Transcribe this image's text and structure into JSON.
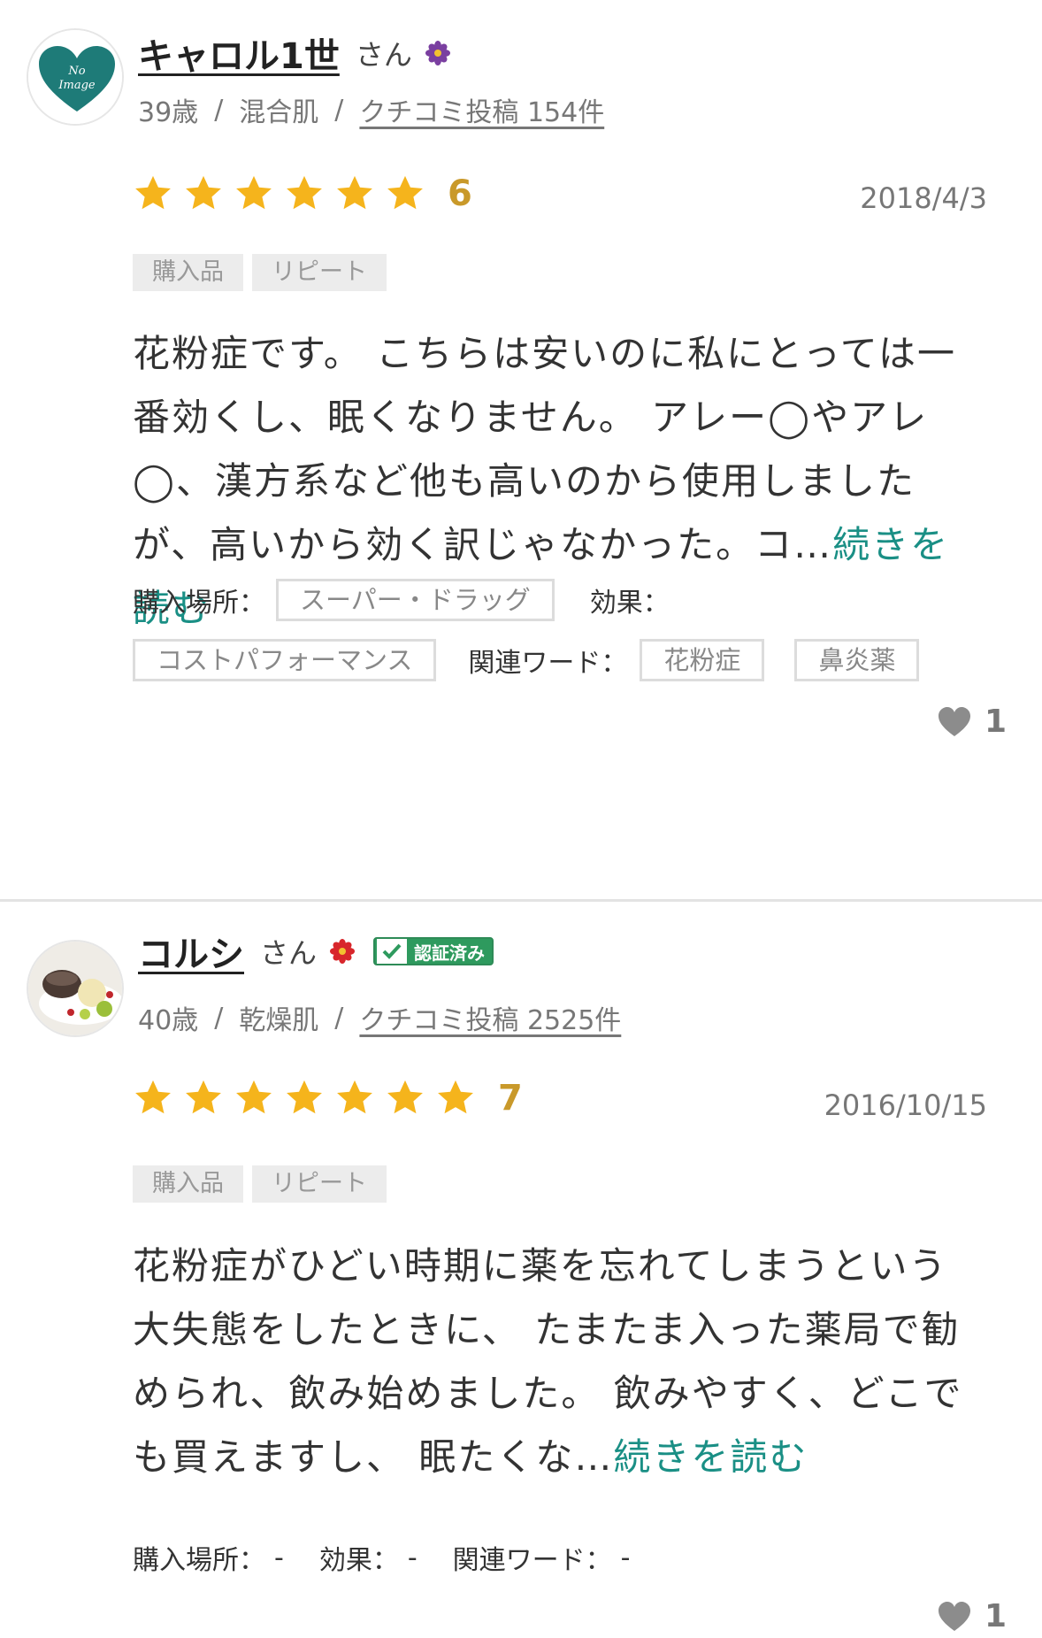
{
  "reviews": [
    {
      "user_name": "キャロル1世",
      "honorific": "さん",
      "age": "39歳",
      "skin_type": "混合肌",
      "post_count": "クチコミ投稿 154件",
      "avatar_text": "No Image",
      "rating": 6,
      "rating_max": 7,
      "score": "6",
      "date": "2018/4/3",
      "tags": [
        "購入品",
        "リピート"
      ],
      "body": "花粉症です。 こちらは安いのに私にとっては一番効くし、眠くなりません。 アレー◯やアレ◯、漢方系など他も高いのから使用しましたが、高いから効く訳じゃなかった。コ…",
      "read_more": "続きを読む",
      "purchase_label": "購入場所：",
      "purchase_value": "スーパー・ドラッグ",
      "effect_label": "効果：",
      "effect_value": "コストパフォーマンス",
      "keyword_label": "関連ワード：",
      "keywords": [
        "花粉症",
        "鼻炎薬"
      ],
      "likes": "1",
      "flower_color": "#7a3fa0"
    },
    {
      "user_name": "コルシ",
      "honorific": "さん",
      "verified_label": "認証済み",
      "age": "40歳",
      "skin_type": "乾燥肌",
      "post_count": "クチコミ投稿 2525件",
      "rating": 7,
      "rating_max": 7,
      "score": "7",
      "date": "2016/10/15",
      "tags": [
        "購入品",
        "リピート"
      ],
      "body": "花粉症がひどい時期に薬を忘れてしまうという大失態をしたときに、 たまたま入った薬局で勧められ、飲み始めました。 飲みやすく、どこでも買えますし、 眠たくな…",
      "read_more": "続きを読む",
      "purchase_label": "購入場所：",
      "purchase_value": "-",
      "effect_label": "効果：",
      "effect_value": "-",
      "keyword_label": "関連ワード：",
      "keyword_value": "-",
      "likes": "1",
      "flower_color": "#d8262b"
    }
  ],
  "separator": "/",
  "colors": {
    "star": "#f5b41c",
    "score": "#c9992a",
    "link": "#1a8f85",
    "verified": "#2e9a5e"
  }
}
